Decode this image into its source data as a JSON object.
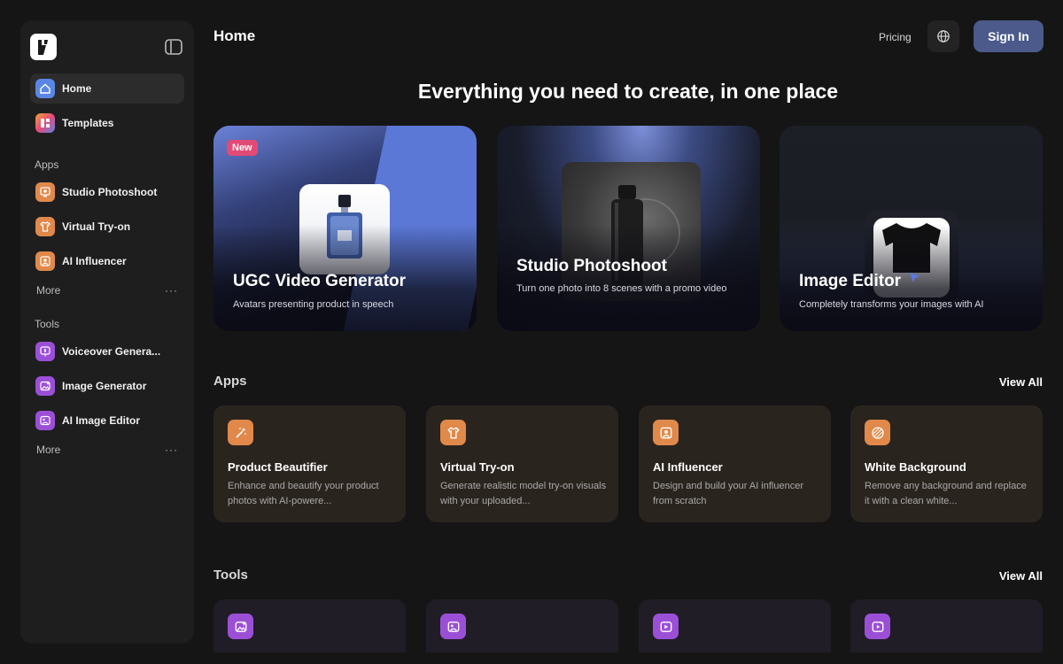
{
  "page": {
    "title": "Home"
  },
  "header": {
    "pricing_label": "Pricing",
    "signin_label": "Sign In"
  },
  "sidebar": {
    "items": [
      {
        "label": "Home",
        "icon": "home-icon",
        "color": "#5a86e6"
      },
      {
        "label": "Templates",
        "icon": "templates-icon",
        "color": "#e64a7a"
      }
    ],
    "apps_label": "Apps",
    "apps": [
      {
        "label": "Studio Photoshoot",
        "icon": "photoshoot-icon",
        "color": "#e0894a"
      },
      {
        "label": "Virtual Try-on",
        "icon": "shirt-icon",
        "color": "#e0894a"
      },
      {
        "label": "AI Influencer",
        "icon": "influencer-icon",
        "color": "#e0894a"
      }
    ],
    "apps_more": "More",
    "tools_label": "Tools",
    "tools": [
      {
        "label": "Voiceover Genera...",
        "icon": "voiceover-icon",
        "color": "#9b4fd6"
      },
      {
        "label": "Image Generator",
        "icon": "image-generator-icon",
        "color": "#9b4fd6"
      },
      {
        "label": "AI Image Editor",
        "icon": "image-editor-icon",
        "color": "#9b4fd6"
      }
    ],
    "tools_more": "More"
  },
  "hero": {
    "headline": "Everything you need to create, in one place"
  },
  "features": [
    {
      "title": "UGC Video Generator",
      "subtitle": "Avatars presenting product in speech",
      "badge": "New"
    },
    {
      "title": "Studio Photoshoot",
      "subtitle": "Turn one photo into 8 scenes with a promo video"
    },
    {
      "title": "Image Editor",
      "subtitle": "Completely transforms your images with AI"
    }
  ],
  "apps_section": {
    "heading": "Apps",
    "view_all": "View All",
    "cards": [
      {
        "title": "Product Beautifier",
        "desc": "Enhance and beautify your product photos with AI-powere...",
        "icon": "magic-wand-icon"
      },
      {
        "title": "Virtual Try-on",
        "desc": "Generate realistic model try-on visuals with your uploaded...",
        "icon": "shirt-icon"
      },
      {
        "title": "AI Influencer",
        "desc": "Design and build your AI influencer from scratch",
        "icon": "influencer-icon"
      },
      {
        "title": "White Background",
        "desc": "Remove any background and replace it with a clean white...",
        "icon": "background-icon"
      }
    ]
  },
  "tools_section": {
    "heading": "Tools",
    "view_all": "View All",
    "cards": [
      {
        "icon": "image-sparkle-icon"
      },
      {
        "icon": "image-edit-icon"
      },
      {
        "icon": "image-video-icon"
      },
      {
        "icon": "video-sparkle-icon"
      }
    ]
  },
  "colors": {
    "accent": "#4b5a8a",
    "app_card": "#2a241f",
    "tool_card": "#201d26",
    "badge": "#e24a76"
  }
}
